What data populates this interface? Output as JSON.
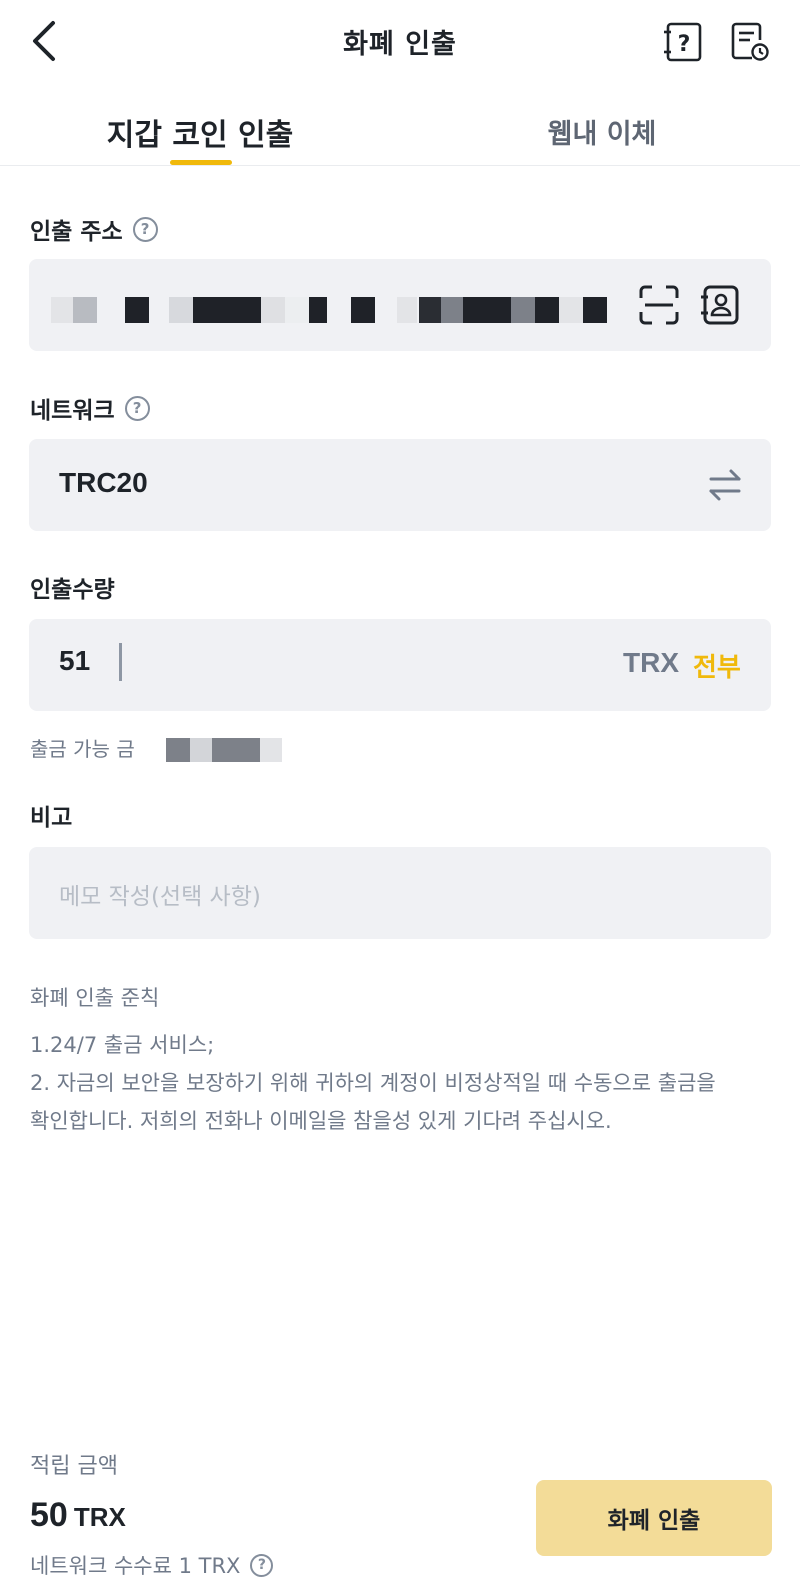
{
  "header": {
    "title": "화폐 인출"
  },
  "tabs": [
    {
      "label": "지갑 코인 인출",
      "active": true
    },
    {
      "label": "웹내 이체",
      "active": false
    }
  ],
  "address": {
    "label": "인출 주소"
  },
  "network": {
    "label": "네트워크",
    "value": "TRC20"
  },
  "amount": {
    "label": "인출수량",
    "value": "51",
    "unit": "TRX",
    "max_label": "전부",
    "available_label": "출금 가능 금"
  },
  "memo": {
    "label": "비고",
    "placeholder": "메모 작성(선택 사항)"
  },
  "rules": {
    "title": "화폐 인출 준칙",
    "lines": [
      "1.24/7 출금 서비스;",
      "2. 자금의 보안을 보장하기 위해 귀하의 계정이 비정상적일 때 수동으로 출금을",
      "확인합니다. 저희의 전화나 이메일을 참을성 있게 기다려 주십시오."
    ]
  },
  "footer": {
    "arrival_label": "적립 금액",
    "arrival_value": "50",
    "arrival_unit": "TRX",
    "fee_label": "네트워크 수수료 1 TRX",
    "withdraw_label": "화폐 인출"
  },
  "colors": {
    "accent": "#f0b90b",
    "button_bg": "#f3dc98",
    "input_bg": "#f0f1f4",
    "text_primary": "#1e2329",
    "text_secondary": "#707a8a"
  },
  "icons": {
    "back": "chevron-left-icon",
    "help": "help-document-icon",
    "history": "history-document-icon",
    "scan": "scan-icon",
    "contact": "address-book-icon",
    "swap": "swap-arrows-icon",
    "info": "question-circle-icon"
  }
}
